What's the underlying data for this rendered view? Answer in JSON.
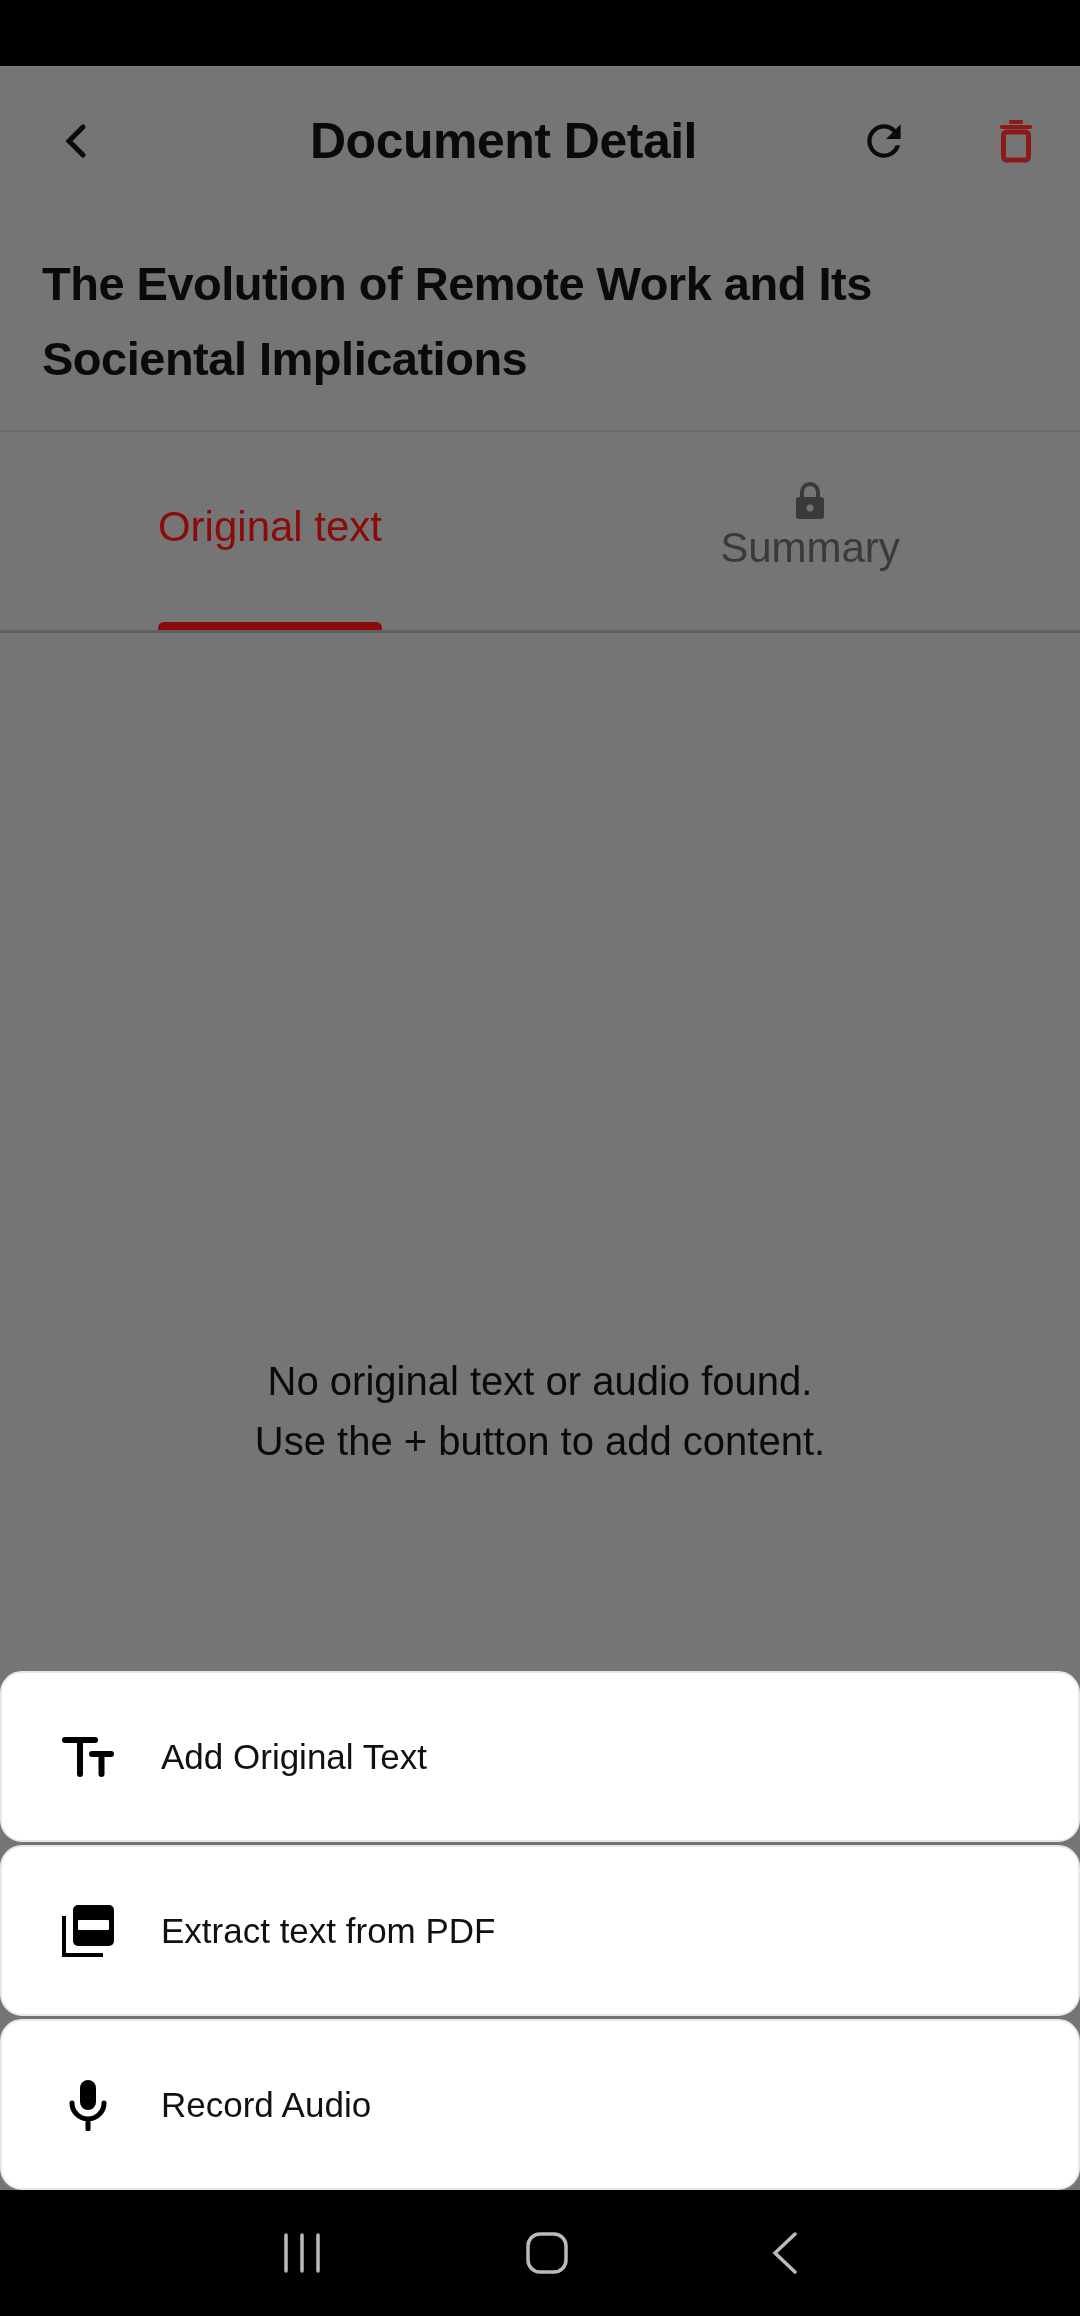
{
  "header": {
    "title": "Document Detail"
  },
  "document": {
    "title": "The Evolution of Remote Work and Its Sociental Implications"
  },
  "tabs": [
    {
      "label": "Original text",
      "selected": true,
      "locked": false
    },
    {
      "label": "Summary",
      "selected": false,
      "locked": true
    }
  ],
  "empty_state": {
    "lines": [
      "No original text or audio found.",
      "Use the + button to add content."
    ]
  },
  "actions": [
    {
      "kind": "text",
      "label": "Add Original Text"
    },
    {
      "kind": "pdf",
      "label": "Extract text from PDF"
    },
    {
      "kind": "audio",
      "label": "Record Audio"
    }
  ]
}
